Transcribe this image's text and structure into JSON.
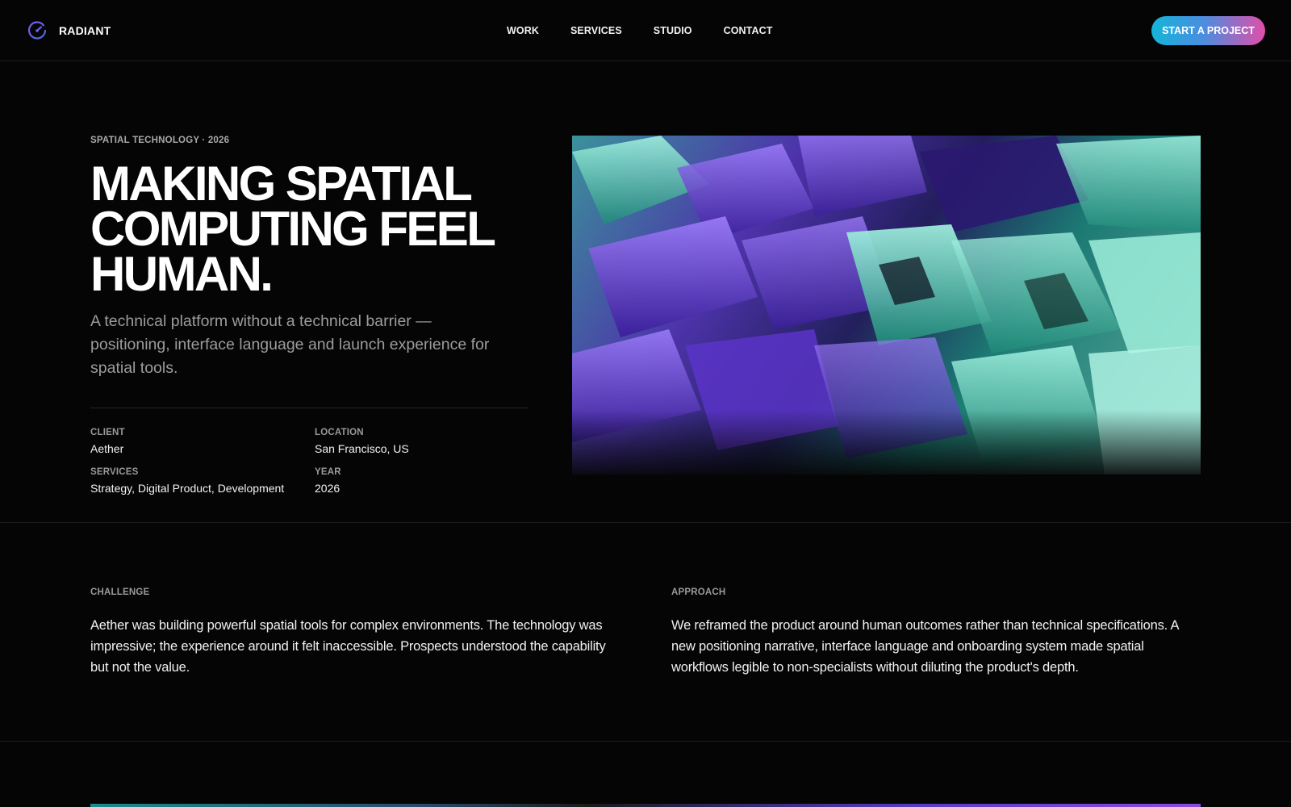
{
  "brand": {
    "name": "RADIANT",
    "logo_icon": "gauge-icon",
    "accent": "#6a4ae0"
  },
  "nav": {
    "items": [
      "WORK",
      "SERVICES",
      "STUDIO",
      "CONTACT"
    ]
  },
  "cta": {
    "label": "START A PROJECT",
    "gradient": [
      "#14b5d9",
      "#e04ea8"
    ]
  },
  "hero": {
    "eyebrow": "SPATIAL TECHNOLOGY · 2026",
    "title_lines": [
      "MAKING SPATIAL",
      "COMPUTING FEEL",
      "HUMAN."
    ],
    "lede": "A technical platform without a technical barrier — positioning, interface language and launch experience for spatial tools.",
    "meta": [
      {
        "label": "CLIENT",
        "value": "Aether"
      },
      {
        "label": "LOCATION",
        "value": "San Francisco, US"
      },
      {
        "label": "SERVICES",
        "value": "Strategy, Digital Product, Development"
      },
      {
        "label": "YEAR",
        "value": "2026"
      }
    ],
    "image": {
      "subject": "abstract glass blocks in violet and teal",
      "colors": [
        "#6a3de0",
        "#4cd6c6",
        "#20a58e"
      ]
    }
  },
  "challenge": {
    "label": "CHALLENGE",
    "text": "Aether was building powerful spatial tools for complex environments. The technology was impressive; the experience around it felt inaccessible. Prospects understood the capability but not the value."
  },
  "approach": {
    "label": "APPROACH",
    "text": "We reframed the product around human outcomes rather than technical specifications. A new positioning narrative, interface language and onboarding system made spatial workflows legible to non-specialists without diluting the product's depth."
  }
}
